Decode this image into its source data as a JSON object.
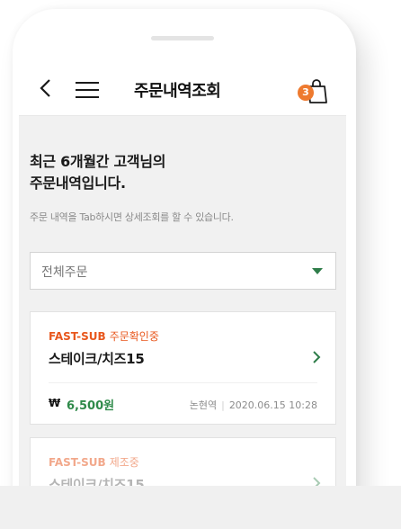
{
  "header": {
    "title": "주문내역조회",
    "cart_count": "3"
  },
  "intro": {
    "line1": "최근 6개월간 고객님의",
    "line2": "주문내역입니다.",
    "note": "주문 내역을 Tab하시면 상세조회를 할 수 있습니다."
  },
  "filter": {
    "selected": "전체주문"
  },
  "orders": [
    {
      "brand": "FAST-SUB",
      "status": "주문확인중",
      "menu": "스테이크/치즈15",
      "currency_symbol": "₩",
      "price": "6,500원",
      "store": "논현역",
      "datetime": "2020.06.15 10:28"
    },
    {
      "brand": "FAST-SUB",
      "status": "제조중",
      "menu": "스테이크/치즈15"
    }
  ],
  "colors": {
    "accent_orange": "#e8571d",
    "price_green": "#2f8a4a",
    "badge_orange": "#ee7a2f"
  }
}
